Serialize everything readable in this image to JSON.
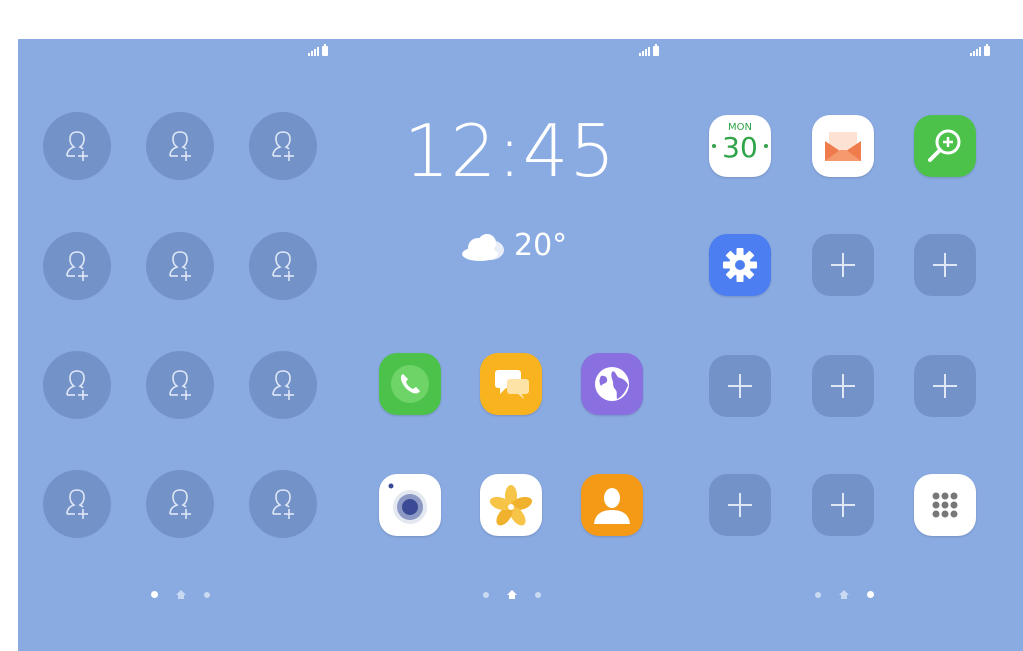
{
  "clock": {
    "time": "12:45"
  },
  "weather": {
    "temperature": "20°",
    "icon": "cloud-icon"
  },
  "calendar": {
    "month": "MON",
    "day": "30"
  },
  "pages": [
    {
      "name": "contacts-page",
      "active_dot": 0
    },
    {
      "name": "main-page",
      "active_dot": 1
    },
    {
      "name": "apps-page",
      "active_dot": 2
    }
  ],
  "apps": {
    "calendar": "calendar-icon",
    "email": "email-icon",
    "finder": "search-zoom-icon",
    "settings": "gear-icon",
    "phone": "phone-icon",
    "messages": "messages-icon",
    "internet": "globe-icon",
    "camera": "camera-icon",
    "gallery": "gallery-flower-icon",
    "contacts": "contacts-icon",
    "apps_drawer": "apps-grid-icon"
  },
  "colors": {
    "background": "#8aaae2",
    "phone": "#4cc24b",
    "messages": "#f8b31f",
    "internet": "#8a6fe0",
    "contacts": "#f59a17",
    "settings": "#4c7ef2",
    "finder": "#4cc24b"
  }
}
